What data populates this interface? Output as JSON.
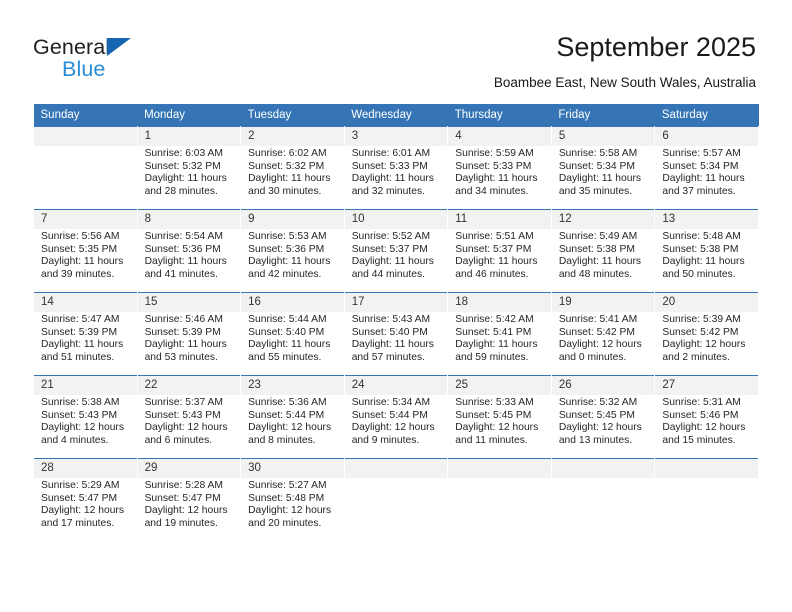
{
  "brand": {
    "name_top": "General",
    "name_bottom": "Blue",
    "triangle_color": "#1565b0",
    "blue_color": "#2b8bd4"
  },
  "header": {
    "title": "September 2025",
    "subtitle": "Boambee East, New South Wales, Australia"
  },
  "calendar": {
    "header_color": "#3575b5",
    "daynum_bg": "#f2f2f2",
    "weekdays": [
      "Sunday",
      "Monday",
      "Tuesday",
      "Wednesday",
      "Thursday",
      "Friday",
      "Saturday"
    ],
    "weeks": [
      [
        {
          "day": "",
          "sunrise": "",
          "sunset": "",
          "daylight1": "",
          "daylight2": "",
          "blank": true
        },
        {
          "day": "1",
          "sunrise": "Sunrise: 6:03 AM",
          "sunset": "Sunset: 5:32 PM",
          "daylight1": "Daylight: 11 hours",
          "daylight2": "and 28 minutes."
        },
        {
          "day": "2",
          "sunrise": "Sunrise: 6:02 AM",
          "sunset": "Sunset: 5:32 PM",
          "daylight1": "Daylight: 11 hours",
          "daylight2": "and 30 minutes."
        },
        {
          "day": "3",
          "sunrise": "Sunrise: 6:01 AM",
          "sunset": "Sunset: 5:33 PM",
          "daylight1": "Daylight: 11 hours",
          "daylight2": "and 32 minutes."
        },
        {
          "day": "4",
          "sunrise": "Sunrise: 5:59 AM",
          "sunset": "Sunset: 5:33 PM",
          "daylight1": "Daylight: 11 hours",
          "daylight2": "and 34 minutes."
        },
        {
          "day": "5",
          "sunrise": "Sunrise: 5:58 AM",
          "sunset": "Sunset: 5:34 PM",
          "daylight1": "Daylight: 11 hours",
          "daylight2": "and 35 minutes."
        },
        {
          "day": "6",
          "sunrise": "Sunrise: 5:57 AM",
          "sunset": "Sunset: 5:34 PM",
          "daylight1": "Daylight: 11 hours",
          "daylight2": "and 37 minutes."
        }
      ],
      [
        {
          "day": "7",
          "sunrise": "Sunrise: 5:56 AM",
          "sunset": "Sunset: 5:35 PM",
          "daylight1": "Daylight: 11 hours",
          "daylight2": "and 39 minutes."
        },
        {
          "day": "8",
          "sunrise": "Sunrise: 5:54 AM",
          "sunset": "Sunset: 5:36 PM",
          "daylight1": "Daylight: 11 hours",
          "daylight2": "and 41 minutes."
        },
        {
          "day": "9",
          "sunrise": "Sunrise: 5:53 AM",
          "sunset": "Sunset: 5:36 PM",
          "daylight1": "Daylight: 11 hours",
          "daylight2": "and 42 minutes."
        },
        {
          "day": "10",
          "sunrise": "Sunrise: 5:52 AM",
          "sunset": "Sunset: 5:37 PM",
          "daylight1": "Daylight: 11 hours",
          "daylight2": "and 44 minutes."
        },
        {
          "day": "11",
          "sunrise": "Sunrise: 5:51 AM",
          "sunset": "Sunset: 5:37 PM",
          "daylight1": "Daylight: 11 hours",
          "daylight2": "and 46 minutes."
        },
        {
          "day": "12",
          "sunrise": "Sunrise: 5:49 AM",
          "sunset": "Sunset: 5:38 PM",
          "daylight1": "Daylight: 11 hours",
          "daylight2": "and 48 minutes."
        },
        {
          "day": "13",
          "sunrise": "Sunrise: 5:48 AM",
          "sunset": "Sunset: 5:38 PM",
          "daylight1": "Daylight: 11 hours",
          "daylight2": "and 50 minutes."
        }
      ],
      [
        {
          "day": "14",
          "sunrise": "Sunrise: 5:47 AM",
          "sunset": "Sunset: 5:39 PM",
          "daylight1": "Daylight: 11 hours",
          "daylight2": "and 51 minutes."
        },
        {
          "day": "15",
          "sunrise": "Sunrise: 5:46 AM",
          "sunset": "Sunset: 5:39 PM",
          "daylight1": "Daylight: 11 hours",
          "daylight2": "and 53 minutes."
        },
        {
          "day": "16",
          "sunrise": "Sunrise: 5:44 AM",
          "sunset": "Sunset: 5:40 PM",
          "daylight1": "Daylight: 11 hours",
          "daylight2": "and 55 minutes."
        },
        {
          "day": "17",
          "sunrise": "Sunrise: 5:43 AM",
          "sunset": "Sunset: 5:40 PM",
          "daylight1": "Daylight: 11 hours",
          "daylight2": "and 57 minutes."
        },
        {
          "day": "18",
          "sunrise": "Sunrise: 5:42 AM",
          "sunset": "Sunset: 5:41 PM",
          "daylight1": "Daylight: 11 hours",
          "daylight2": "and 59 minutes."
        },
        {
          "day": "19",
          "sunrise": "Sunrise: 5:41 AM",
          "sunset": "Sunset: 5:42 PM",
          "daylight1": "Daylight: 12 hours",
          "daylight2": "and 0 minutes."
        },
        {
          "day": "20",
          "sunrise": "Sunrise: 5:39 AM",
          "sunset": "Sunset: 5:42 PM",
          "daylight1": "Daylight: 12 hours",
          "daylight2": "and 2 minutes."
        }
      ],
      [
        {
          "day": "21",
          "sunrise": "Sunrise: 5:38 AM",
          "sunset": "Sunset: 5:43 PM",
          "daylight1": "Daylight: 12 hours",
          "daylight2": "and 4 minutes."
        },
        {
          "day": "22",
          "sunrise": "Sunrise: 5:37 AM",
          "sunset": "Sunset: 5:43 PM",
          "daylight1": "Daylight: 12 hours",
          "daylight2": "and 6 minutes."
        },
        {
          "day": "23",
          "sunrise": "Sunrise: 5:36 AM",
          "sunset": "Sunset: 5:44 PM",
          "daylight1": "Daylight: 12 hours",
          "daylight2": "and 8 minutes."
        },
        {
          "day": "24",
          "sunrise": "Sunrise: 5:34 AM",
          "sunset": "Sunset: 5:44 PM",
          "daylight1": "Daylight: 12 hours",
          "daylight2": "and 9 minutes."
        },
        {
          "day": "25",
          "sunrise": "Sunrise: 5:33 AM",
          "sunset": "Sunset: 5:45 PM",
          "daylight1": "Daylight: 12 hours",
          "daylight2": "and 11 minutes."
        },
        {
          "day": "26",
          "sunrise": "Sunrise: 5:32 AM",
          "sunset": "Sunset: 5:45 PM",
          "daylight1": "Daylight: 12 hours",
          "daylight2": "and 13 minutes."
        },
        {
          "day": "27",
          "sunrise": "Sunrise: 5:31 AM",
          "sunset": "Sunset: 5:46 PM",
          "daylight1": "Daylight: 12 hours",
          "daylight2": "and 15 minutes."
        }
      ],
      [
        {
          "day": "28",
          "sunrise": "Sunrise: 5:29 AM",
          "sunset": "Sunset: 5:47 PM",
          "daylight1": "Daylight: 12 hours",
          "daylight2": "and 17 minutes."
        },
        {
          "day": "29",
          "sunrise": "Sunrise: 5:28 AM",
          "sunset": "Sunset: 5:47 PM",
          "daylight1": "Daylight: 12 hours",
          "daylight2": "and 19 minutes."
        },
        {
          "day": "30",
          "sunrise": "Sunrise: 5:27 AM",
          "sunset": "Sunset: 5:48 PM",
          "daylight1": "Daylight: 12 hours",
          "daylight2": "and 20 minutes."
        },
        {
          "day": "",
          "sunrise": "",
          "sunset": "",
          "daylight1": "",
          "daylight2": "",
          "blank": true
        },
        {
          "day": "",
          "sunrise": "",
          "sunset": "",
          "daylight1": "",
          "daylight2": "",
          "blank": true
        },
        {
          "day": "",
          "sunrise": "",
          "sunset": "",
          "daylight1": "",
          "daylight2": "",
          "blank": true
        },
        {
          "day": "",
          "sunrise": "",
          "sunset": "",
          "daylight1": "",
          "daylight2": "",
          "blank": true
        }
      ]
    ]
  }
}
